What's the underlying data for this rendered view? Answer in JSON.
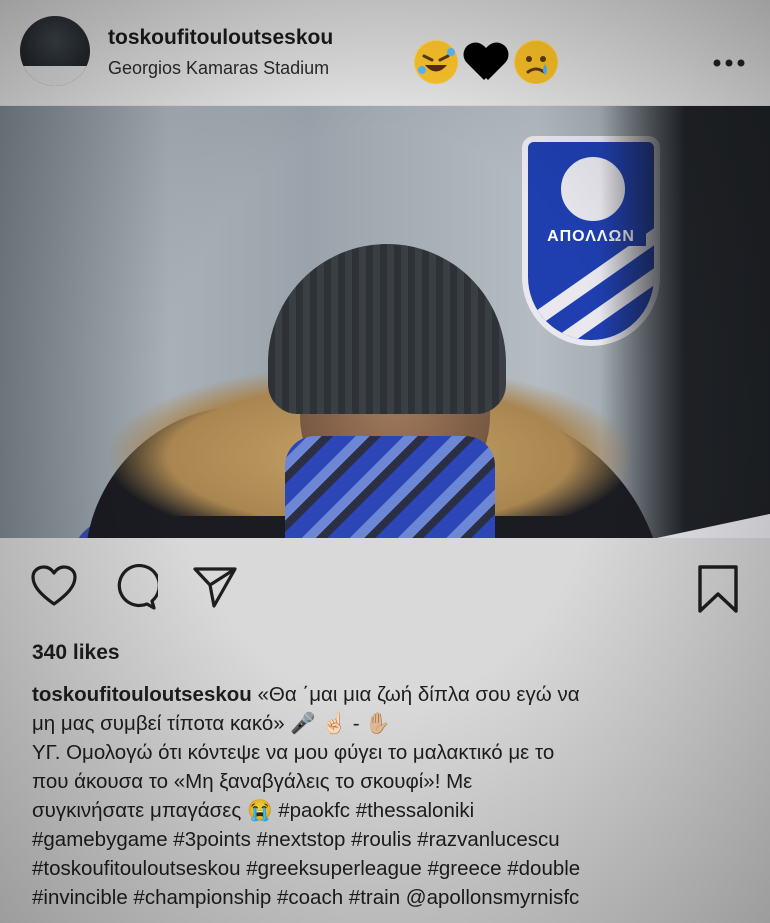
{
  "post": {
    "username": "toskoufitouloutseskou",
    "location": "Georgios Kamaras Stadium",
    "header_emojis": [
      "🤣",
      "🖤",
      "😢"
    ],
    "more_icon": "more-horizontal-icon",
    "likes": "340 likes"
  },
  "photo": {
    "crest_text": "ΑΠΟΛΛΩΝ"
  },
  "actions": {
    "like_icon": "heart-icon",
    "comment_icon": "comment-icon",
    "share_icon": "send-icon",
    "save_icon": "bookmark-icon"
  },
  "caption": {
    "username": "toskoufitouloutseskou",
    "line1": " «Θα ΄μαι μια ζωή δίπλα σου εγώ να",
    "line2": "μη μας συμβεί τίποτα κακό» 🎤 ☝🏻 - ✋🏼",
    "line3": "ΥΓ. Ομολογώ ότι κόντεψε να μου φύγει το μαλακτικό με το",
    "line4": "που άκουσα το «Μη ξαναβγάλεις το σκουφί»! Με",
    "line5": "συγκινήσατε μπαγάσες 😭 #paokfc #thessaloniki",
    "line6": "#gamebygame #3points #nextstop #roulis #razvanlucescu",
    "line7": "#toskoufitouloutseskou #greeksuperleague #greece #double",
    "line8": "#invincible #championship #coach #train @apollonsmyrnisfc"
  },
  "colors": {
    "background": "#d9d9d9",
    "text": "#1c1c1c",
    "crest_blue": "#1f3fb0"
  }
}
